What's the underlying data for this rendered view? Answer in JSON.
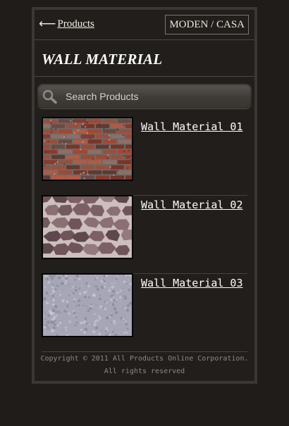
{
  "header": {
    "back_label": "Products",
    "back_icon": "left-arrow-icon",
    "brand": "MODEN / CASA"
  },
  "page": {
    "title": "WALL MATERIAL"
  },
  "search": {
    "placeholder": "Search Products",
    "value": "",
    "icon": "search-icon"
  },
  "products": [
    {
      "name": "Wall Material 01",
      "texture": "red-brick"
    },
    {
      "name": "Wall Material 02",
      "texture": "flagstone"
    },
    {
      "name": "Wall Material 03",
      "texture": "grey-stucco"
    }
  ],
  "footer": {
    "line1": "Copyright © 2011 All Products Online Corporation.",
    "line2": "All rights reserved"
  },
  "colors": {
    "background": "#1f1c19",
    "panel": "#211e1b",
    "panel_border": "#3a3835",
    "text": "#ffffff",
    "muted_text": "#8d8a85"
  }
}
